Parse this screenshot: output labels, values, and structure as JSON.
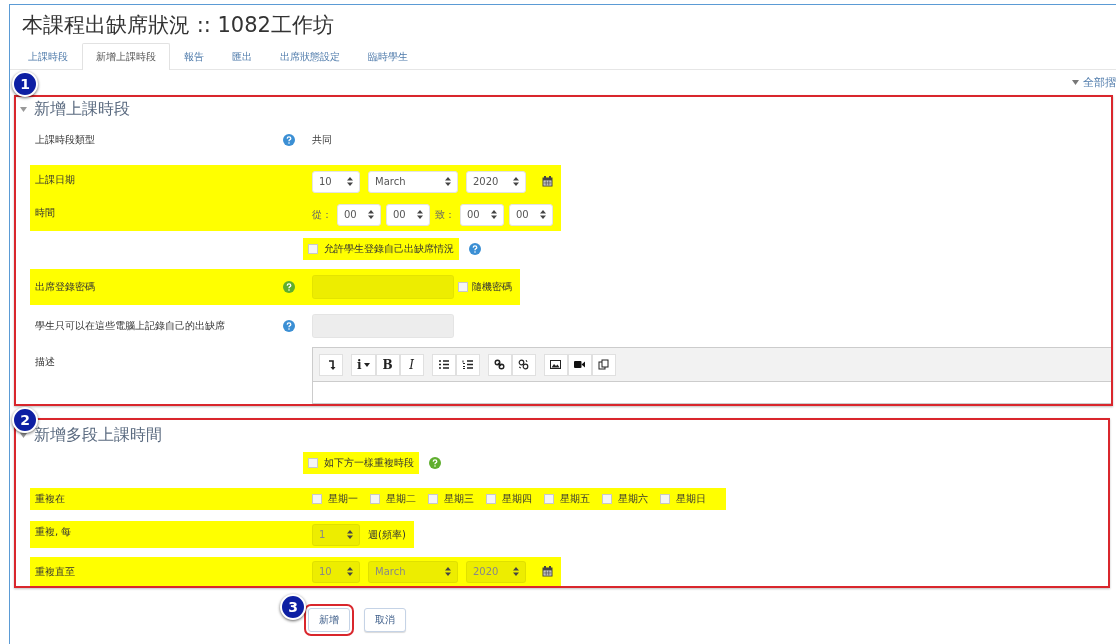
{
  "page": {
    "title": "本課程出缺席狀況 :: 1082工作坊"
  },
  "tabs": [
    {
      "label": "上課時段",
      "selected": false
    },
    {
      "label": "新增上課時段",
      "selected": true
    },
    {
      "label": "報告",
      "selected": false
    },
    {
      "label": "匯出",
      "selected": false
    },
    {
      "label": "出席狀態設定",
      "selected": false
    },
    {
      "label": "臨時學生",
      "selected": false
    }
  ],
  "collapse_all": "全部摺",
  "sections": [
    {
      "badge": "1",
      "title": "新增上課時段",
      "outlined": true,
      "rows": [
        {
          "kind": "text",
          "label": "上課時段類型",
          "help": {
            "color": "#3b8fd4"
          },
          "value": "共同",
          "highlighted": false
        },
        {
          "kind": "date",
          "label": "上課日期",
          "highlighted": true,
          "selects": [
            {
              "value": "10",
              "disabled": false
            },
            {
              "value": "March",
              "disabled": false
            },
            {
              "value": "2020",
              "disabled": false
            }
          ]
        },
        {
          "kind": "time",
          "label": "時間",
          "highlighted": true,
          "from": "從：",
          "to": "致：",
          "selects": [
            {
              "value": "00",
              "disabled": false
            },
            {
              "value": "00",
              "disabled": false
            },
            {
              "value": "00",
              "disabled": false
            },
            {
              "value": "00",
              "disabled": false
            }
          ]
        },
        {
          "kind": "checkbox",
          "text": "允許學生登錄自己出缺席情況",
          "checked": false,
          "help": {
            "color": "#3b8fd4"
          },
          "highlighted": true
        },
        {
          "kind": "password",
          "label": "出席登錄密碼",
          "help": {
            "color": "#5fae2e"
          },
          "highlighted": true,
          "field_disabled": true,
          "option": {
            "text": "隨機密碼",
            "checked": false
          }
        },
        {
          "kind": "input",
          "label": "學生只可以在這些電腦上記錄自己的出缺席",
          "help": {
            "color": "#3b8fd4"
          },
          "field_disabled": true,
          "highlighted": false
        },
        {
          "kind": "editor",
          "label": "描述",
          "highlighted": false,
          "toolbar": [
            [
              {
                "kind": "icon"
              }
            ],
            [
              {
                "kind": "menu",
                "label": "i"
              },
              {
                "kind": "bold",
                "label": "B"
              },
              {
                "kind": "italic",
                "label": "I"
              }
            ],
            [
              {
                "kind": "icon"
              },
              {
                "kind": "icon"
              }
            ],
            [
              {
                "kind": "icon"
              },
              {
                "kind": "icon"
              }
            ],
            [
              {
                "kind": "icon"
              },
              {
                "kind": "icon"
              },
              {
                "kind": "icon"
              }
            ]
          ]
        }
      ]
    },
    {
      "badge": "2",
      "title": "新增多段上課時間",
      "outlined": true,
      "rows": [
        {
          "kind": "checkbox",
          "text": "如下方一樣重複時段",
          "checked": false,
          "help": {
            "color": "#5fae2e"
          },
          "highlighted": true
        },
        {
          "kind": "weekdays",
          "label": "重複在",
          "highlighted": true,
          "days": [
            {
              "label": "星期一",
              "checked": false
            },
            {
              "label": "星期二",
              "checked": false
            },
            {
              "label": "星期三",
              "checked": false
            },
            {
              "label": "星期四",
              "checked": false
            },
            {
              "label": "星期五",
              "checked": false
            },
            {
              "label": "星期六",
              "checked": false
            },
            {
              "label": "星期日",
              "checked": false
            }
          ]
        },
        {
          "kind": "repeat",
          "label": "重複, 每",
          "highlighted": true,
          "select": {
            "value": "1",
            "disabled": true
          },
          "unit": "週(頻率)"
        },
        {
          "kind": "date",
          "label": "重複直至",
          "highlighted": true,
          "selects": [
            {
              "value": "10",
              "disabled": true
            },
            {
              "value": "March",
              "disabled": true
            },
            {
              "value": "2020",
              "disabled": true
            }
          ]
        }
      ]
    }
  ],
  "buttons": [
    {
      "label": "新增",
      "outlined": true,
      "badge": "3"
    },
    {
      "label": "取消",
      "outlined": false
    }
  ]
}
